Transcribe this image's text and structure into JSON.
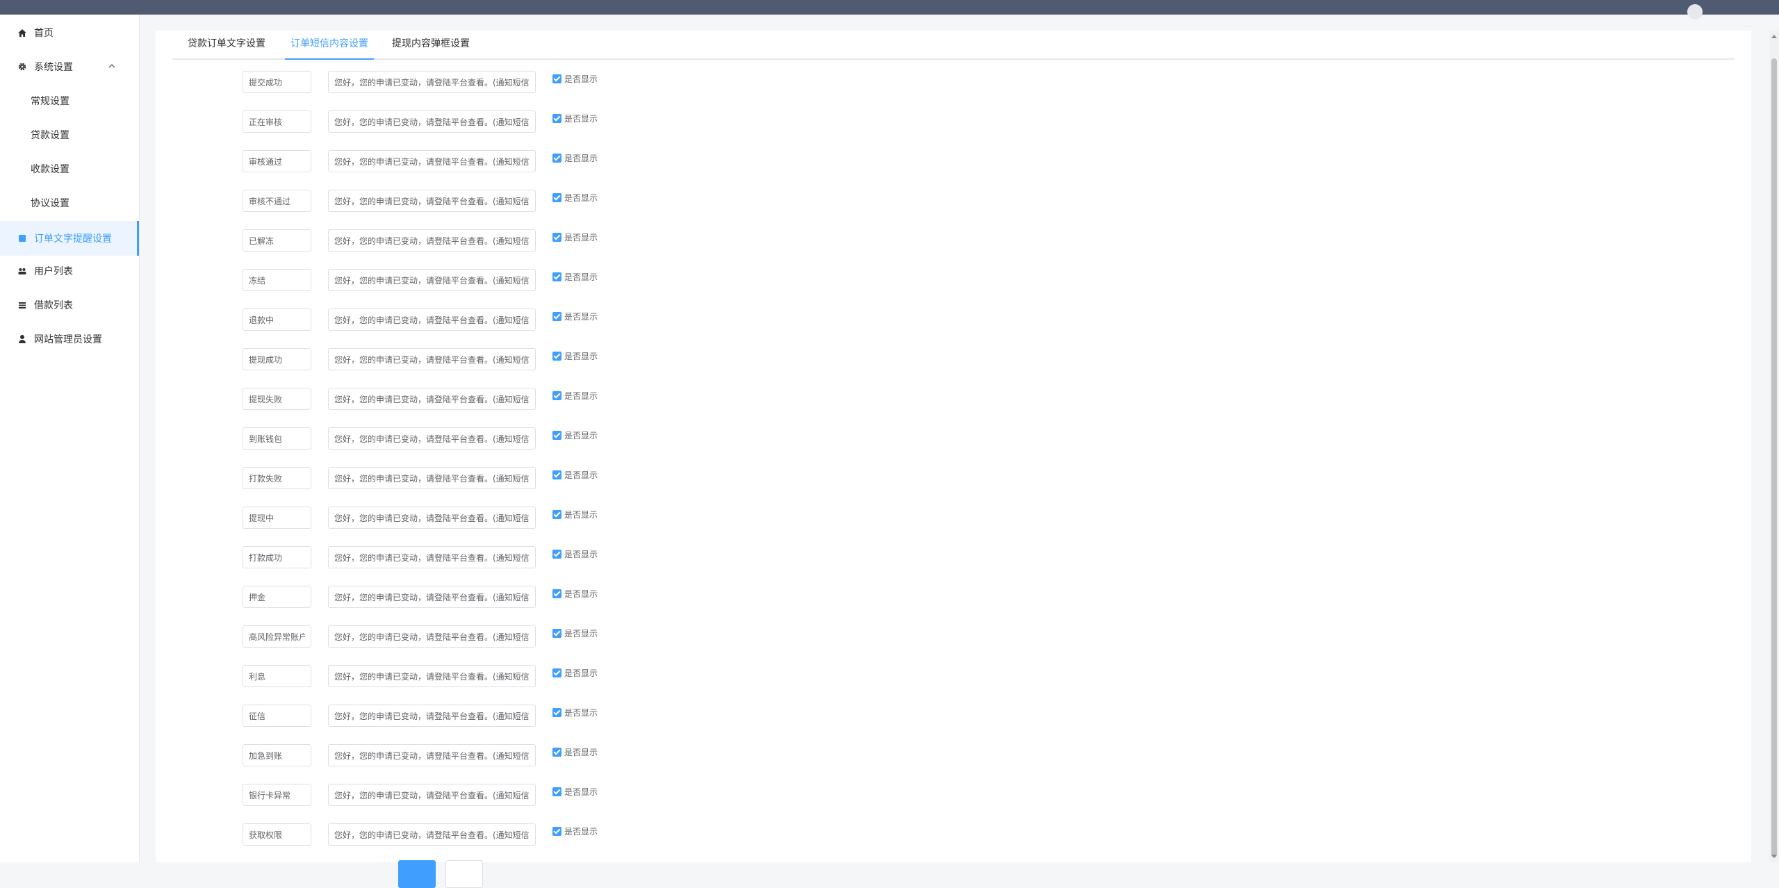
{
  "colors": {
    "header_bg": "#505a70",
    "accent": "#409eff",
    "active_bg": "#ecf5ff"
  },
  "sidebar": {
    "home": {
      "label": "首页",
      "icon": "home-icon"
    },
    "system": {
      "label": "系统设置",
      "icon": "gear-icon",
      "expanded": true
    },
    "system_children": [
      {
        "label": "常规设置"
      },
      {
        "label": "贷款设置"
      },
      {
        "label": "收款设置"
      },
      {
        "label": "协议设置"
      }
    ],
    "order_text": {
      "label": "订单文字提醒设置",
      "icon": "document-icon",
      "active": true
    },
    "users": {
      "label": "用户列表",
      "icon": "users-icon"
    },
    "loans": {
      "label": "借款列表",
      "icon": "list-icon"
    },
    "admins": {
      "label": "网站管理员设置",
      "icon": "user-icon"
    }
  },
  "tabs": [
    {
      "label": "贷款订单文字设置"
    },
    {
      "label": "订单短信内容设置",
      "active": true
    },
    {
      "label": "提现内容弹框设置"
    }
  ],
  "sms": {
    "message": "您好，您的申请已变动，请登陆平台查看。(通知短信,",
    "checkbox_label": "是否显示",
    "rows": [
      {
        "name": "提交成功",
        "checked": true
      },
      {
        "name": "正在审核",
        "checked": true
      },
      {
        "name": "审核通过",
        "checked": true
      },
      {
        "name": "审核不通过",
        "checked": true
      },
      {
        "name": "已解冻",
        "checked": true
      },
      {
        "name": "冻结",
        "checked": true
      },
      {
        "name": "退款中",
        "checked": true
      },
      {
        "name": "提现成功",
        "checked": true
      },
      {
        "name": "提现失败",
        "checked": true
      },
      {
        "name": "到账钱包",
        "checked": true
      },
      {
        "name": "打款失败",
        "checked": true
      },
      {
        "name": "提现中",
        "checked": true
      },
      {
        "name": "打款成功",
        "checked": true
      },
      {
        "name": "押金",
        "checked": true
      },
      {
        "name": "高风险异常账户",
        "checked": true
      },
      {
        "name": "利息",
        "checked": true
      },
      {
        "name": "征信",
        "checked": true
      },
      {
        "name": "加急到账",
        "checked": true
      },
      {
        "name": "银行卡异常",
        "checked": true
      },
      {
        "name": "获取权限",
        "checked": true
      }
    ]
  }
}
